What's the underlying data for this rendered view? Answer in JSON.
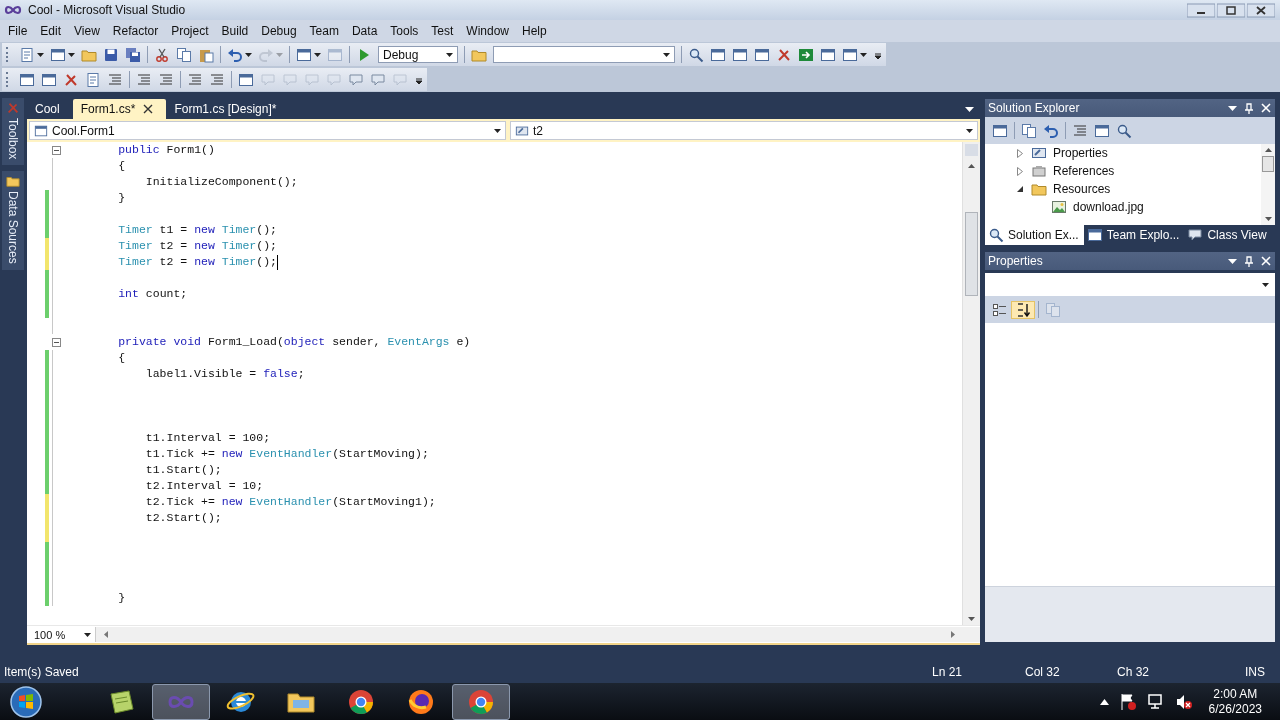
{
  "window": {
    "title": "Cool - Microsoft Visual Studio"
  },
  "menu": [
    "File",
    "Edit",
    "View",
    "Refactor",
    "Project",
    "Build",
    "Debug",
    "Team",
    "Data",
    "Tools",
    "Test",
    "Window",
    "Help"
  ],
  "toolbars": [
    [
      {
        "kind": "split",
        "disabled": false
      },
      {
        "kind": "split",
        "disabled": false
      },
      {
        "kind": "button",
        "disabled": false
      },
      {
        "kind": "button",
        "disabled": false
      },
      {
        "kind": "button",
        "disabled": false
      },
      {
        "kind": "separator"
      },
      {
        "kind": "button",
        "disabled": false
      },
      {
        "kind": "button",
        "disabled": false
      },
      {
        "kind": "button",
        "disabled": false
      },
      {
        "kind": "separator"
      },
      {
        "kind": "split",
        "disabled": false
      },
      {
        "kind": "split",
        "disabled": true
      },
      {
        "kind": "separator"
      },
      {
        "kind": "split",
        "disabled": false
      },
      {
        "kind": "button",
        "disabled": true
      },
      {
        "kind": "separator"
      },
      {
        "kind": "button",
        "disabled": false
      },
      {
        "kind": "combo",
        "value": "Debug"
      },
      {
        "kind": "separator"
      },
      {
        "kind": "button",
        "disabled": false
      },
      {
        "kind": "combo"
      },
      {
        "kind": "separator"
      },
      {
        "kind": "button",
        "disabled": false
      },
      {
        "kind": "button",
        "disabled": false
      },
      {
        "kind": "button",
        "disabled": false
      },
      {
        "kind": "button",
        "disabled": false
      },
      {
        "kind": "button",
        "disabled": false
      },
      {
        "kind": "button",
        "disabled": false
      },
      {
        "kind": "button",
        "disabled": false
      },
      {
        "kind": "split",
        "disabled": false
      },
      {
        "kind": "overflow"
      }
    ],
    [
      {
        "kind": "button",
        "disabled": false
      },
      {
        "kind": "button",
        "disabled": false
      },
      {
        "kind": "button",
        "disabled": false
      },
      {
        "kind": "button",
        "disabled": false
      },
      {
        "kind": "button",
        "disabled": false
      },
      {
        "kind": "separator"
      },
      {
        "kind": "button",
        "disabled": false
      },
      {
        "kind": "button",
        "disabled": false
      },
      {
        "kind": "separator"
      },
      {
        "kind": "button",
        "disabled": false
      },
      {
        "kind": "button",
        "disabled": false
      },
      {
        "kind": "separator"
      },
      {
        "kind": "button",
        "disabled": false
      },
      {
        "kind": "button",
        "disabled": true
      },
      {
        "kind": "button",
        "disabled": true
      },
      {
        "kind": "button",
        "disabled": true
      },
      {
        "kind": "button",
        "disabled": true
      },
      {
        "kind": "button",
        "disabled": false
      },
      {
        "kind": "button",
        "disabled": false
      },
      {
        "kind": "button",
        "disabled": true
      },
      {
        "kind": "overflow"
      }
    ]
  ],
  "side_tabs": [
    {
      "label": "Toolbox"
    },
    {
      "label": "Data Sources"
    }
  ],
  "doc_tabs": [
    {
      "label": "Cool",
      "selected": false,
      "closable": false
    },
    {
      "label": "Form1.cs*",
      "selected": true,
      "closable": true
    },
    {
      "label": "Form1.cs [Design]*",
      "selected": false,
      "closable": false
    }
  ],
  "navigation": {
    "type_combo": "Cool.Form1",
    "member_combo": "t2"
  },
  "editor": {
    "zoom": "100 %",
    "lines": [
      {
        "modified": false,
        "foldable": true,
        "expanded": true,
        "tokens": [
          {
            "kind": "keyword",
            "text": "        public"
          },
          {
            "kind": "plain",
            "text": " Form1()"
          }
        ]
      },
      {
        "modified": false,
        "tokens": [
          {
            "kind": "plain",
            "text": "        {"
          }
        ]
      },
      {
        "modified": false,
        "tokens": [
          {
            "kind": "plain",
            "text": "            InitializeComponent();"
          }
        ]
      },
      {
        "modified": true,
        "saved": true,
        "tokens": [
          {
            "kind": "plain",
            "text": "        }"
          }
        ]
      },
      {
        "modified": true,
        "saved": true
      },
      {
        "modified": true,
        "saved": true,
        "tokens": [
          {
            "kind": "type",
            "text": "        Timer"
          },
          {
            "kind": "plain",
            "text": " t1 = "
          },
          {
            "kind": "keyword",
            "text": "new "
          },
          {
            "kind": "type",
            "text": "Timer"
          },
          {
            "kind": "plain",
            "text": "();"
          }
        ]
      },
      {
        "modified": true,
        "saved": false,
        "tokens": [
          {
            "kind": "type",
            "text": "        Timer"
          },
          {
            "kind": "plain",
            "text": " t2 = "
          },
          {
            "kind": "keyword",
            "text": "new "
          },
          {
            "kind": "type",
            "text": "Timer"
          },
          {
            "kind": "plain",
            "text": "();"
          }
        ]
      },
      {
        "modified": true,
        "saved": false,
        "caret": true,
        "tokens": [
          {
            "kind": "type",
            "text": "        Timer"
          },
          {
            "kind": "plain",
            "text": " t2 = "
          },
          {
            "kind": "keyword",
            "text": "new "
          },
          {
            "kind": "type",
            "text": "Timer"
          },
          {
            "kind": "plain",
            "text": "();"
          }
        ]
      },
      {
        "modified": true,
        "saved": true
      },
      {
        "modified": true,
        "saved": true,
        "tokens": [
          {
            "kind": "keyword",
            "text": "        int"
          },
          {
            "kind": "plain",
            "text": " count;"
          }
        ]
      },
      {
        "modified": true,
        "saved": true
      },
      {
        "modified": false
      },
      {
        "modified": false,
        "foldable": true,
        "expanded": true,
        "tokens": [
          {
            "kind": "keyword",
            "text": "        private void"
          },
          {
            "kind": "plain",
            "text": " Form1_Load("
          },
          {
            "kind": "keyword",
            "text": "object"
          },
          {
            "kind": "plain",
            "text": " sender, "
          },
          {
            "kind": "type",
            "text": "EventArgs"
          },
          {
            "kind": "plain",
            "text": " e)"
          }
        ]
      },
      {
        "modified": true,
        "saved": true,
        "tokens": [
          {
            "kind": "plain",
            "text": "        {"
          }
        ]
      },
      {
        "modified": true,
        "saved": true,
        "tokens": [
          {
            "kind": "plain",
            "text": "            label1.Visible = "
          },
          {
            "kind": "keyword",
            "text": "false"
          },
          {
            "kind": "plain",
            "text": ";"
          }
        ]
      },
      {
        "modified": true,
        "saved": true
      },
      {
        "modified": true,
        "saved": true
      },
      {
        "modified": true,
        "saved": true
      },
      {
        "modified": true,
        "saved": true,
        "tokens": [
          {
            "kind": "plain",
            "text": "            t1.Interval = 100;"
          }
        ]
      },
      {
        "modified": true,
        "saved": true,
        "tokens": [
          {
            "kind": "plain",
            "text": "            t1.Tick += "
          },
          {
            "kind": "keyword",
            "text": "new "
          },
          {
            "kind": "type",
            "text": "EventHandler"
          },
          {
            "kind": "plain",
            "text": "(StartMoving);"
          }
        ]
      },
      {
        "modified": true,
        "saved": true,
        "tokens": [
          {
            "kind": "plain",
            "text": "            t1.Start();"
          }
        ]
      },
      {
        "modified": true,
        "saved": true,
        "tokens": [
          {
            "kind": "plain",
            "text": "            t2.Interval = 10;"
          }
        ]
      },
      {
        "modified": true,
        "saved": false,
        "tokens": [
          {
            "kind": "plain",
            "text": "            t2.Tick += "
          },
          {
            "kind": "keyword",
            "text": "new "
          },
          {
            "kind": "type",
            "text": "EventHandler"
          },
          {
            "kind": "plain",
            "text": "(StartMoving1);"
          }
        ]
      },
      {
        "modified": true,
        "saved": false,
        "tokens": [
          {
            "kind": "plain",
            "text": "            t2.Start();"
          }
        ]
      },
      {
        "modified": true,
        "saved": false
      },
      {
        "modified": true,
        "saved": true
      },
      {
        "modified": true,
        "saved": true
      },
      {
        "modified": true,
        "saved": true
      },
      {
        "modified": true,
        "saved": true,
        "tokens": [
          {
            "kind": "plain",
            "text": "        }"
          }
        ]
      }
    ]
  },
  "solution_explorer": {
    "title": "Solution Explorer",
    "tree": [
      {
        "label": "Properties",
        "expanded": false
      },
      {
        "label": "References",
        "expanded": false
      },
      {
        "label": "Resources",
        "expanded": true,
        "children": [
          {
            "label": "download.jpg"
          }
        ]
      }
    ]
  },
  "panel_tabs": [
    {
      "label": "Solution Ex...",
      "selected": true
    },
    {
      "label": "Team Explo...",
      "selected": false
    },
    {
      "label": "Class View",
      "selected": false
    }
  ],
  "properties": {
    "title": "Properties",
    "toolbar": [
      {
        "selected": false,
        "disabled": false
      },
      {
        "selected": true,
        "disabled": false
      },
      {
        "selected": false,
        "disabled": true
      }
    ]
  },
  "status_bar": {
    "message": "Item(s) Saved",
    "line": "Ln 21",
    "column": "Col 32",
    "char": "Ch 32",
    "mode": "INS"
  },
  "taskbar": {
    "apps": [
      {
        "active": false
      },
      {
        "active": true
      },
      {
        "active": false
      },
      {
        "active": false
      },
      {
        "active": false
      },
      {
        "active": false
      },
      {
        "active": true
      }
    ],
    "time": "2:00 AM",
    "date": "6/26/2023"
  }
}
